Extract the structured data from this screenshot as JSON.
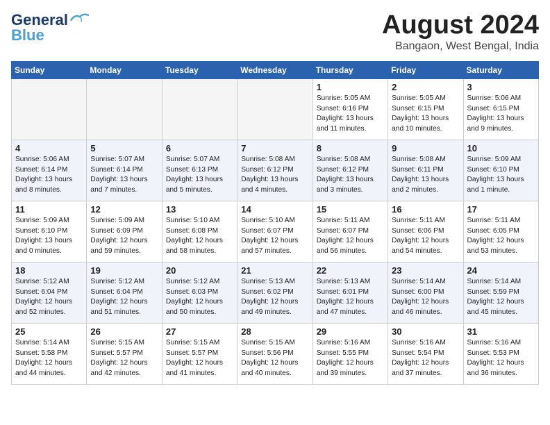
{
  "header": {
    "logo_general": "General",
    "logo_blue": "Blue",
    "month_year": "August 2024",
    "location": "Bangaon, West Bengal, India"
  },
  "days_of_week": [
    "Sunday",
    "Monday",
    "Tuesday",
    "Wednesday",
    "Thursday",
    "Friday",
    "Saturday"
  ],
  "weeks": [
    [
      {
        "day": "",
        "info": ""
      },
      {
        "day": "",
        "info": ""
      },
      {
        "day": "",
        "info": ""
      },
      {
        "day": "",
        "info": ""
      },
      {
        "day": "1",
        "info": "Sunrise: 5:05 AM\nSunset: 6:16 PM\nDaylight: 13 hours\nand 11 minutes."
      },
      {
        "day": "2",
        "info": "Sunrise: 5:05 AM\nSunset: 6:15 PM\nDaylight: 13 hours\nand 10 minutes."
      },
      {
        "day": "3",
        "info": "Sunrise: 5:06 AM\nSunset: 6:15 PM\nDaylight: 13 hours\nand 9 minutes."
      }
    ],
    [
      {
        "day": "4",
        "info": "Sunrise: 5:06 AM\nSunset: 6:14 PM\nDaylight: 13 hours\nand 8 minutes."
      },
      {
        "day": "5",
        "info": "Sunrise: 5:07 AM\nSunset: 6:14 PM\nDaylight: 13 hours\nand 7 minutes."
      },
      {
        "day": "6",
        "info": "Sunrise: 5:07 AM\nSunset: 6:13 PM\nDaylight: 13 hours\nand 5 minutes."
      },
      {
        "day": "7",
        "info": "Sunrise: 5:08 AM\nSunset: 6:12 PM\nDaylight: 13 hours\nand 4 minutes."
      },
      {
        "day": "8",
        "info": "Sunrise: 5:08 AM\nSunset: 6:12 PM\nDaylight: 13 hours\nand 3 minutes."
      },
      {
        "day": "9",
        "info": "Sunrise: 5:08 AM\nSunset: 6:11 PM\nDaylight: 13 hours\nand 2 minutes."
      },
      {
        "day": "10",
        "info": "Sunrise: 5:09 AM\nSunset: 6:10 PM\nDaylight: 13 hours\nand 1 minute."
      }
    ],
    [
      {
        "day": "11",
        "info": "Sunrise: 5:09 AM\nSunset: 6:10 PM\nDaylight: 13 hours\nand 0 minutes."
      },
      {
        "day": "12",
        "info": "Sunrise: 5:09 AM\nSunset: 6:09 PM\nDaylight: 12 hours\nand 59 minutes."
      },
      {
        "day": "13",
        "info": "Sunrise: 5:10 AM\nSunset: 6:08 PM\nDaylight: 12 hours\nand 58 minutes."
      },
      {
        "day": "14",
        "info": "Sunrise: 5:10 AM\nSunset: 6:07 PM\nDaylight: 12 hours\nand 57 minutes."
      },
      {
        "day": "15",
        "info": "Sunrise: 5:11 AM\nSunset: 6:07 PM\nDaylight: 12 hours\nand 56 minutes."
      },
      {
        "day": "16",
        "info": "Sunrise: 5:11 AM\nSunset: 6:06 PM\nDaylight: 12 hours\nand 54 minutes."
      },
      {
        "day": "17",
        "info": "Sunrise: 5:11 AM\nSunset: 6:05 PM\nDaylight: 12 hours\nand 53 minutes."
      }
    ],
    [
      {
        "day": "18",
        "info": "Sunrise: 5:12 AM\nSunset: 6:04 PM\nDaylight: 12 hours\nand 52 minutes."
      },
      {
        "day": "19",
        "info": "Sunrise: 5:12 AM\nSunset: 6:04 PM\nDaylight: 12 hours\nand 51 minutes."
      },
      {
        "day": "20",
        "info": "Sunrise: 5:12 AM\nSunset: 6:03 PM\nDaylight: 12 hours\nand 50 minutes."
      },
      {
        "day": "21",
        "info": "Sunrise: 5:13 AM\nSunset: 6:02 PM\nDaylight: 12 hours\nand 49 minutes."
      },
      {
        "day": "22",
        "info": "Sunrise: 5:13 AM\nSunset: 6:01 PM\nDaylight: 12 hours\nand 47 minutes."
      },
      {
        "day": "23",
        "info": "Sunrise: 5:14 AM\nSunset: 6:00 PM\nDaylight: 12 hours\nand 46 minutes."
      },
      {
        "day": "24",
        "info": "Sunrise: 5:14 AM\nSunset: 5:59 PM\nDaylight: 12 hours\nand 45 minutes."
      }
    ],
    [
      {
        "day": "25",
        "info": "Sunrise: 5:14 AM\nSunset: 5:58 PM\nDaylight: 12 hours\nand 44 minutes."
      },
      {
        "day": "26",
        "info": "Sunrise: 5:15 AM\nSunset: 5:57 PM\nDaylight: 12 hours\nand 42 minutes."
      },
      {
        "day": "27",
        "info": "Sunrise: 5:15 AM\nSunset: 5:57 PM\nDaylight: 12 hours\nand 41 minutes."
      },
      {
        "day": "28",
        "info": "Sunrise: 5:15 AM\nSunset: 5:56 PM\nDaylight: 12 hours\nand 40 minutes."
      },
      {
        "day": "29",
        "info": "Sunrise: 5:16 AM\nSunset: 5:55 PM\nDaylight: 12 hours\nand 39 minutes."
      },
      {
        "day": "30",
        "info": "Sunrise: 5:16 AM\nSunset: 5:54 PM\nDaylight: 12 hours\nand 37 minutes."
      },
      {
        "day": "31",
        "info": "Sunrise: 5:16 AM\nSunset: 5:53 PM\nDaylight: 12 hours\nand 36 minutes."
      }
    ]
  ]
}
